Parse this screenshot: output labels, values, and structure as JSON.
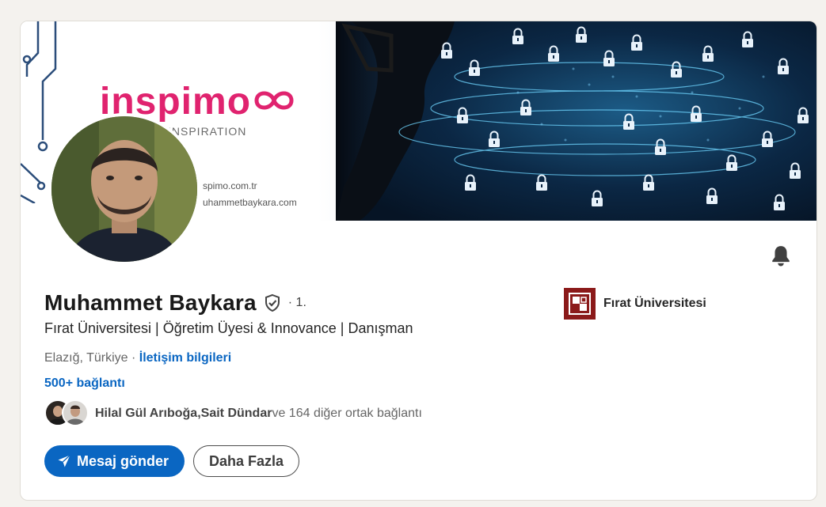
{
  "banner": {
    "brand_name": "inspimo",
    "brand_tagline": "INSPIRATION",
    "website_line1": "spimo.com.tr",
    "website_line2": "uhammetbaykara.com",
    "brand_color": "#e0236f"
  },
  "profile": {
    "name": "Muhammet Baykara",
    "degree": "· 1.",
    "headline": "Fırat Üniversitesi | Öğretim Üyesi & Innovance | Danışman",
    "location": "Elazığ, Türkiye",
    "separator": " · ",
    "contact_info": "İletişim bilgileri",
    "connections": "500+ bağlantı",
    "mutual": {
      "name1": "Hilal Gül Arıboğa",
      "comma": ", ",
      "name2": "Sait Dündar",
      "rest": " ve 164 diğer ortak bağlantı"
    }
  },
  "actions": {
    "message": "Mesaj gönder",
    "more": "Daha Fazla"
  },
  "education": {
    "name": "Fırat Üniversitesi",
    "logo_color": "#8b1a1a"
  },
  "icons": {
    "verified": "verified-shield-icon",
    "bell": "bell-icon",
    "send": "send-icon"
  },
  "colors": {
    "accent": "#0a66c2",
    "background": "#f4f2ee"
  }
}
